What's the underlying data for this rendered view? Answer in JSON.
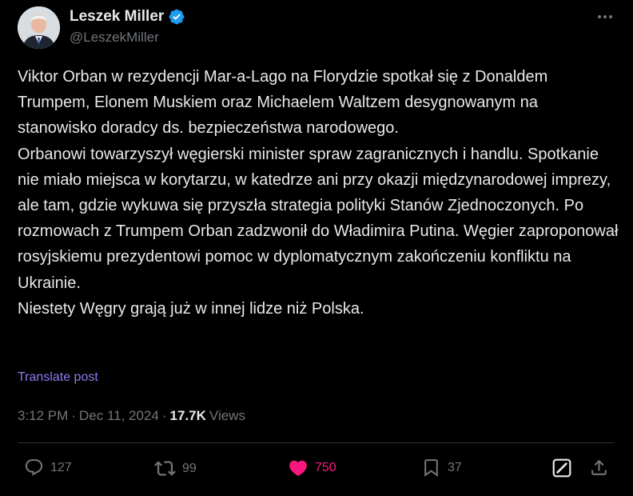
{
  "author": {
    "display_name": "Leszek Miller",
    "handle": "@LeszekMiller",
    "verified": true
  },
  "post": {
    "paragraphs": [
      "Viktor Orban w rezydencji Mar-a-Lago na Florydzie spotkał się z Donaldem Trumpem, Elonem Muskiem oraz Michaelem Waltzem desygnowanym na stanowisko doradcy ds. bezpieczeństwa narodowego.",
      "Orbanowi towarzyszył węgierski minister spraw zagranicznych i handlu. Spotkanie nie miało miejsca w korytarzu, w katedrze ani przy okazji międzynarodowej imprezy, ale tam, gdzie wykuwa się przyszła strategia polityki Stanów Zjednoczonych. Po rozmowach z Trumpem Orban zadzwonił do Władimira Putina. Węgier zaproponował rosyjskiemu prezydentowi pomoc w dyplomatycznym zakończeniu konfliktu na Ukrainie.",
      "Niestety Węgry grają już w innej lidze niż Polska."
    ],
    "translate_label": "Translate post",
    "time": "3:12 PM",
    "separator": "·",
    "date": "Dec 11, 2024",
    "views_count": "17.7K",
    "views_label": "Views"
  },
  "actions": {
    "replies": "127",
    "reposts": "99",
    "likes": "750",
    "bookmarks": "37"
  },
  "colors": {
    "background": "#000000",
    "text": "#e7e9ea",
    "muted": "#71767b",
    "verified": "#1d9bf0",
    "like": "#f91880",
    "translate_link": "#8b7df0",
    "divider": "#2f3336"
  },
  "icons": {
    "reply": "speech-bubble",
    "repost": "repost-arrows",
    "like": "heart-filled",
    "bookmark": "bookmark",
    "grok": "grok-slash-square",
    "share": "share-upload",
    "more": "three-dots",
    "verified": "verified-badge"
  }
}
